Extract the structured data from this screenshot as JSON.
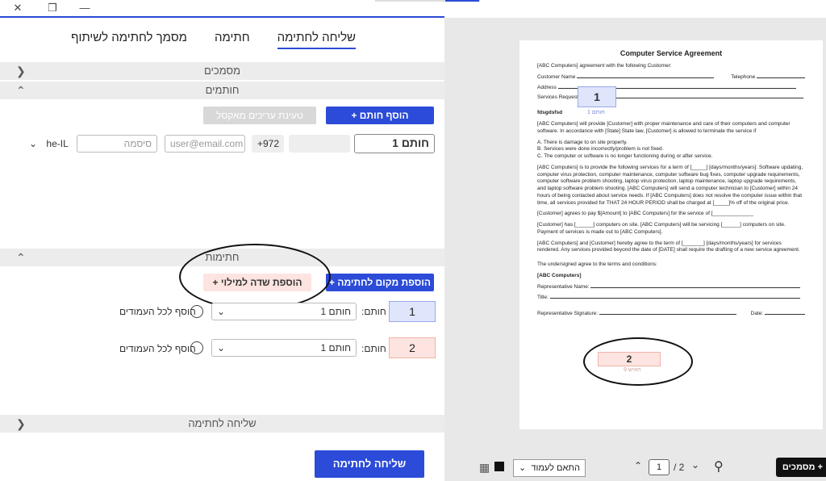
{
  "window": {
    "close_glyph": "✕",
    "restore_glyph": "❐",
    "minimize_glyph": "—"
  },
  "tabs": [
    {
      "label": "שליחה לחתימה"
    },
    {
      "label": "חתימה"
    },
    {
      "label": "מסמך לחתימה לשיתוף"
    }
  ],
  "sections": {
    "documents": "מסמכים",
    "signers": "חותמים",
    "signatures": "חתימות",
    "send": "שליחה לחתימה"
  },
  "signers": {
    "add_signer": "הוסף חותם +",
    "load_contacts": "טעינת עריכים מאקסל",
    "signer_name": "חותם 1",
    "phone_prefix": "+972",
    "email_placeholder": "user@email.com",
    "password_placeholder": "סיסמה",
    "locale": "he-IL"
  },
  "signatures": {
    "add_signature_place": "הוספת מקום לחתימה +",
    "add_fill_field": "הוספת שדה למילוי +",
    "rows": [
      {
        "num": "1",
        "signer_label": "חותם:",
        "signer_value": "חותם 1",
        "all_pages": "הוסף לכל העמודים"
      },
      {
        "num": "2",
        "signer_label": "חותם:",
        "signer_value": "חותם 1",
        "all_pages": "הוסף לכל העמודים"
      }
    ]
  },
  "send_button": "שליחה לחתימה",
  "document": {
    "title": "Computer Service Agreement",
    "intro": "[ABC Computers] agreement with the following Customer:",
    "customer_name": "Customer Name",
    "telephone": "Telephone",
    "address": "Address",
    "services_requested": "Services Requested",
    "heading": "fdsgdsfsd",
    "p1": "[ABC Computers] will provide [Customer] with proper maintenance and care of their computers and computer software. In accordance with [State] State law, [Customer] is allowed to terminate the service if",
    "list_a": "A.  There is damage to on site property.",
    "list_b": "B.  Services were done incorrectly/problem is not fixed.",
    "list_c": "C.  The computer or software is no longer functioning during or after service.",
    "p2": "[ABC Computers] is to provide the following services for a term of [_____] [days/months/years]: Software updating, computer virus protection, computer maintenance, computer software bug fixes, computer upgrade requirements, computer software problem shooting, laptop virus protection, laptop maintenance, laptop upgrade requirements, and laptop software problem shooting. [ABC Computers] will send a computer technician to [Customer] within 24 hours of being contacted about service needs. If [ABC Computers] does not resolve the computer issue within that time, all services provided for THAT 24 HOUR PERIOD shall be charged at [_____]% off of the original price.",
    "p3": "[Customer] agrees to pay $[Amount] to [ABC Computers] for the service of [______________",
    "p4": "[Customer] has [______] computers on site. [ABC Computers] will be servicing [______] computers on site. Payment of services is made out to [ABC Computers].",
    "p5": "[ABC Computers] and [Customer] hereby agree to the term of [_______] [days/months/years] for services rendered. Any services provided beyond the date of [DATE] shall require the drafting of a new service agreement.",
    "p6": "The undersigned agree to the terms and conditions:",
    "company": "[ABC Computers]",
    "rep_name": "Representative Name:",
    "title_field": "Title:",
    "rep_signature": "Representative Signature:",
    "date": "Date:",
    "sig1_num": "1",
    "sig1_caption": "חותם 1",
    "sig2_num": "2",
    "sig2_caption": "האיש 9"
  },
  "viewer": {
    "fit_select": "התאם לעמוד",
    "page_current": "1",
    "page_total": "/ 2",
    "documents_button": "מסמכים +"
  },
  "colors": {
    "accent": "#2b4bd8",
    "signer1": "#dfe5fb",
    "signer2": "#fde4e0"
  }
}
